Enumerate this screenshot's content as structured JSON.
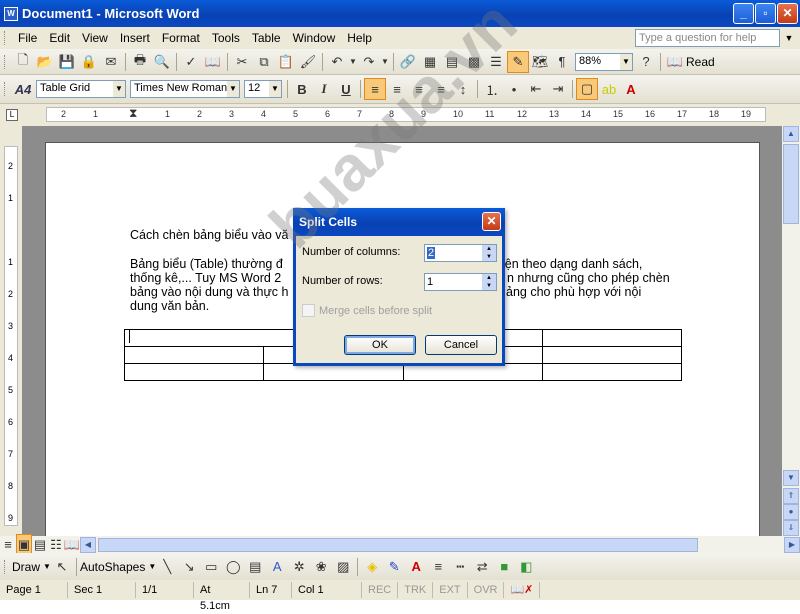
{
  "window": {
    "title": "Document1 - Microsoft Word",
    "app_icon": "W"
  },
  "menubar": {
    "items": [
      "File",
      "Edit",
      "View",
      "Insert",
      "Format",
      "Tools",
      "Table",
      "Window",
      "Help"
    ],
    "ask_placeholder": "Type a question for help"
  },
  "toolbar_standard": {
    "zoom": "88%",
    "read_label": "Read"
  },
  "toolbar_format": {
    "style": "Table Grid",
    "font": "Times New Roman",
    "size": "12",
    "style_icon": "A4"
  },
  "ruler": {
    "ticks": [
      "2",
      "1",
      "1",
      "2",
      "3",
      "4",
      "5",
      "6",
      "7",
      "8",
      "9",
      "10",
      "11",
      "12",
      "13",
      "14",
      "15",
      "16",
      "17",
      "18",
      "19"
    ]
  },
  "vruler": {
    "ticks": [
      "2",
      "1",
      "1",
      "2",
      "3",
      "4",
      "5",
      "6",
      "7",
      "8",
      "9"
    ]
  },
  "document": {
    "line1": "Cách chèn bảng biểu vào vă",
    "para_lines": [
      "Bảng biểu (Table) thường đ",
      "thống kê,... Tuy MS Word 2",
      "bảng vào nội dung và thực h",
      "dung văn bản."
    ],
    "para_right": [
      "iện theo dạng danh sách,",
      "n nhưng cũng cho phép chèn",
      "ảng cho phù hợp với nội"
    ]
  },
  "dialog": {
    "title": "Split Cells",
    "columns_label": "Number of columns:",
    "columns_value": "2",
    "rows_label": "Number of rows:",
    "rows_value": "1",
    "merge_label": "Merge cells before split",
    "ok_label": "OK",
    "cancel_label": "Cancel"
  },
  "drawbar": {
    "draw_label": "Draw",
    "autoshapes_label": "AutoShapes"
  },
  "status": {
    "page": "Page 1",
    "sec": "Sec 1",
    "pages": "1/1",
    "at": "At 5.1cm",
    "ln": "Ln 7",
    "col": "Col 1",
    "rec": "REC",
    "trk": "TRK",
    "ext": "EXT",
    "ovr": "OVR"
  },
  "watermark": "buaxua.vn"
}
